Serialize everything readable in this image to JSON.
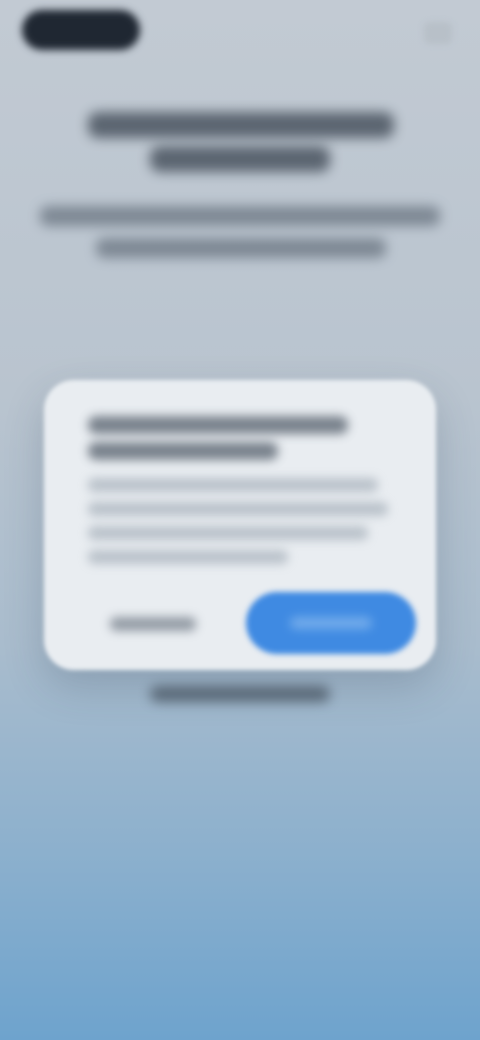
{
  "header": {
    "logo_icon": "logo-icon",
    "corner_icon": "overflow-icon"
  },
  "hero": {},
  "dialog": {},
  "footer": {},
  "colors": {
    "background_top": "#c2cad3",
    "background_bottom": "#6ea3cd",
    "dialog": "#e9edf1",
    "primary_button": "#3f8ae2",
    "text_dark": "#1f2732"
  }
}
